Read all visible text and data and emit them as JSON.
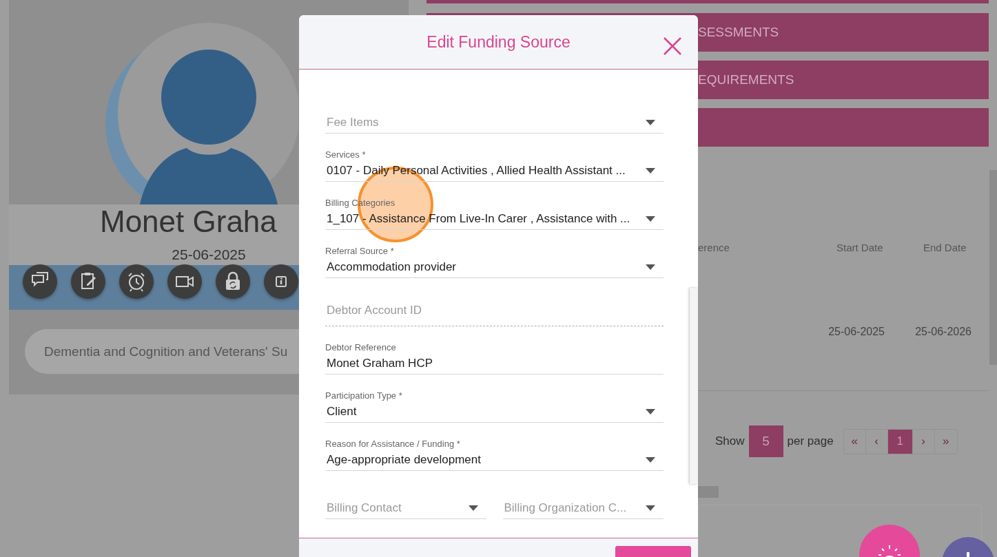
{
  "profile": {
    "name": "Monet Graha",
    "date": "25-06-2025",
    "actions": [
      {
        "kind": "chat"
      },
      {
        "kind": "notes"
      },
      {
        "kind": "alarm"
      },
      {
        "kind": "video"
      },
      {
        "kind": "lock"
      },
      {
        "kind": "info"
      }
    ],
    "tag": "Dementia and Cognition and Veterans' Su"
  },
  "sections": [
    {
      "label": "SESSMENTS"
    },
    {
      "label": "EQUIREMENTS"
    }
  ],
  "table": {
    "columns": [
      "erence",
      "Start Date",
      "End Date"
    ],
    "rows": [
      {
        "start_date": "25-06-2025",
        "end_date": "25-06-2026"
      }
    ]
  },
  "pagination": {
    "show_label": "Show",
    "page_size": "5",
    "per_page_label": "per page",
    "pages": [
      {
        "label": "«",
        "selected": false
      },
      {
        "label": "‹",
        "selected": false
      },
      {
        "label": "1",
        "selected": true
      },
      {
        "label": "›",
        "selected": false
      },
      {
        "label": "»",
        "selected": false
      }
    ]
  },
  "modal": {
    "title": "Edit Funding Source",
    "fields": [
      {
        "kind": "dropdown",
        "placeholder": "Fee Items"
      },
      {
        "kind": "dropdown",
        "label": "Services *",
        "value": "0107 - Daily Personal Activities , Allied Health Assistant ..."
      },
      {
        "kind": "dropdown",
        "label": "Billing Categories",
        "value": "1_107 - Assistance From Live-In Carer , Assistance with ..."
      },
      {
        "kind": "dropdown",
        "label": "Referral Source *",
        "value": "Accommodation provider"
      },
      {
        "kind": "text",
        "placeholder": "Debtor Account ID",
        "disabled": true
      },
      {
        "kind": "text",
        "label": "Debtor Reference",
        "value": "Monet Graham HCP",
        "disabled": false
      },
      {
        "kind": "dropdown",
        "label": "Participation Type *",
        "value": "Client"
      },
      {
        "kind": "dropdown",
        "label": "Reason for Assistance / Funding *",
        "value": "Age-appropriate development"
      },
      {
        "kind": "pair",
        "items": [
          {
            "kind": "dropdown",
            "placeholder": "Billing Contact"
          },
          {
            "kind": "dropdown",
            "placeholder": "Billing Organization C..."
          }
        ]
      }
    ]
  }
}
